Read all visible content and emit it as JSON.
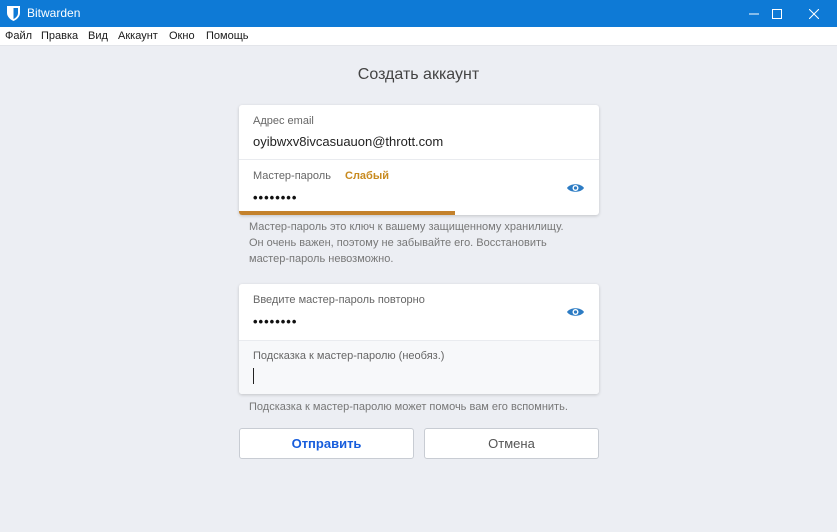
{
  "window": {
    "title": "Bitwarden",
    "colors": {
      "titlebar": "#0e7ad6",
      "accent": "#175ddc",
      "weak": "#c4822c"
    }
  },
  "menu": [
    "Файл",
    "Правка",
    "Вид",
    "Аккаунт",
    "Окно",
    "Помощь"
  ],
  "page": {
    "title": "Создать аккаунт"
  },
  "form": {
    "email_label": "Адрес email",
    "email_value": "oyibwxv8ivcasuauon@thrott.com",
    "master_label": "Мастер-пароль",
    "strength_label": "Слабый",
    "strength_fraction": 0.6,
    "master_value": "••••••••",
    "master_help": [
      "Мастер-пароль это ключ к вашему защищенному хранилищу.",
      "Он очень важен, поэтому не забывайте его. Восстановить",
      "мастер-пароль невозможно."
    ],
    "retype_label": "Введите мастер-пароль повторно",
    "retype_value": "••••••••",
    "hint_label": "Подсказка к мастер-паролю (необяз.)",
    "hint_value": "",
    "hint_help": "Подсказка к мастер-паролю может помочь вам его вспомнить."
  },
  "buttons": {
    "submit": "Отправить",
    "cancel": "Отмена"
  },
  "icons": [
    "bitwarden-shield-icon",
    "minimize-icon",
    "maximize-icon",
    "close-icon",
    "eye-icon"
  ]
}
